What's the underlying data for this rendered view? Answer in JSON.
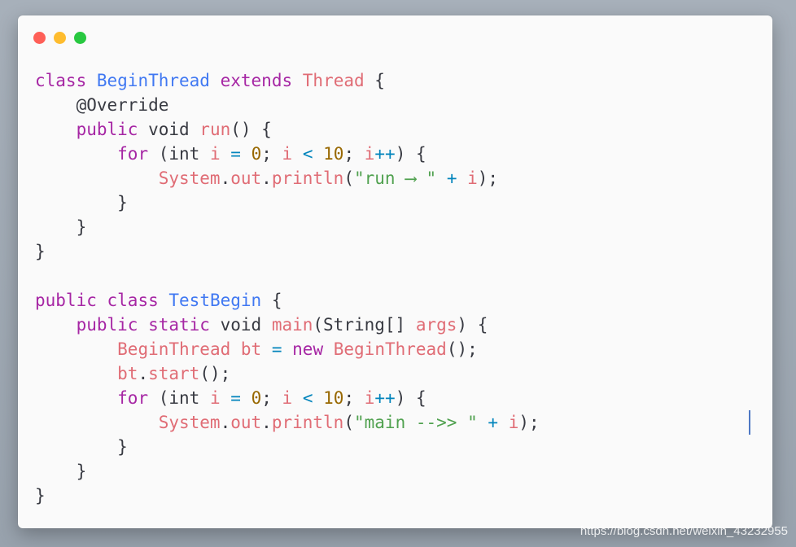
{
  "window": {
    "controls": [
      {
        "name": "close",
        "color": "#fe5f57"
      },
      {
        "name": "minimize",
        "color": "#febc2e"
      },
      {
        "name": "maximize",
        "color": "#28c840"
      }
    ]
  },
  "colors": {
    "keyword": "#a626a4",
    "class_name": "#4078f2",
    "identifier": "#e06c75",
    "number": "#986801",
    "string": "#50a14f",
    "operator": "#0184bc",
    "plain": "#383a42",
    "annotation": "#383a42"
  },
  "code_lines": [
    [
      [
        "keyword",
        "class"
      ],
      [
        "plain",
        " "
      ],
      [
        "class_name",
        "BeginThread"
      ],
      [
        "plain",
        " "
      ],
      [
        "keyword",
        "extends"
      ],
      [
        "plain",
        " "
      ],
      [
        "identifier",
        "Thread"
      ],
      [
        "plain",
        " {"
      ]
    ],
    [
      [
        "plain",
        "    "
      ],
      [
        "annotation",
        "@Override"
      ]
    ],
    [
      [
        "plain",
        "    "
      ],
      [
        "keyword",
        "public"
      ],
      [
        "plain",
        " void "
      ],
      [
        "identifier",
        "run"
      ],
      [
        "plain",
        "() {"
      ]
    ],
    [
      [
        "plain",
        "        "
      ],
      [
        "keyword",
        "for"
      ],
      [
        "plain",
        " (int "
      ],
      [
        "identifier",
        "i"
      ],
      [
        "plain",
        " "
      ],
      [
        "operator",
        "="
      ],
      [
        "plain",
        " "
      ],
      [
        "number",
        "0"
      ],
      [
        "plain",
        "; "
      ],
      [
        "identifier",
        "i"
      ],
      [
        "plain",
        " "
      ],
      [
        "operator",
        "<"
      ],
      [
        "plain",
        " "
      ],
      [
        "number",
        "10"
      ],
      [
        "plain",
        "; "
      ],
      [
        "identifier",
        "i"
      ],
      [
        "operator",
        "++"
      ],
      [
        "plain",
        ") {"
      ]
    ],
    [
      [
        "plain",
        "            "
      ],
      [
        "identifier",
        "System"
      ],
      [
        "plain",
        "."
      ],
      [
        "identifier",
        "out"
      ],
      [
        "plain",
        "."
      ],
      [
        "identifier",
        "println"
      ],
      [
        "plain",
        "("
      ],
      [
        "string",
        "\"run ⟶ \""
      ],
      [
        "plain",
        " "
      ],
      [
        "operator",
        "+"
      ],
      [
        "plain",
        " "
      ],
      [
        "identifier",
        "i"
      ],
      [
        "plain",
        ");"
      ]
    ],
    [
      [
        "plain",
        "        }"
      ]
    ],
    [
      [
        "plain",
        "    }"
      ]
    ],
    [
      [
        "plain",
        "}"
      ]
    ],
    [
      [
        "plain",
        ""
      ]
    ],
    [
      [
        "keyword",
        "public"
      ],
      [
        "plain",
        " "
      ],
      [
        "keyword",
        "class"
      ],
      [
        "plain",
        " "
      ],
      [
        "class_name",
        "TestBegin"
      ],
      [
        "plain",
        " {"
      ]
    ],
    [
      [
        "plain",
        "    "
      ],
      [
        "keyword",
        "public"
      ],
      [
        "plain",
        " "
      ],
      [
        "keyword",
        "static"
      ],
      [
        "plain",
        " void "
      ],
      [
        "identifier",
        "main"
      ],
      [
        "plain",
        "(String[] "
      ],
      [
        "identifier",
        "args"
      ],
      [
        "plain",
        ") {"
      ]
    ],
    [
      [
        "plain",
        "        "
      ],
      [
        "identifier",
        "BeginThread"
      ],
      [
        "plain",
        " "
      ],
      [
        "identifier",
        "bt"
      ],
      [
        "plain",
        " "
      ],
      [
        "operator",
        "="
      ],
      [
        "plain",
        " "
      ],
      [
        "keyword",
        "new"
      ],
      [
        "plain",
        " "
      ],
      [
        "identifier",
        "BeginThread"
      ],
      [
        "plain",
        "();"
      ]
    ],
    [
      [
        "plain",
        "        "
      ],
      [
        "identifier",
        "bt"
      ],
      [
        "plain",
        "."
      ],
      [
        "identifier",
        "start"
      ],
      [
        "plain",
        "();"
      ]
    ],
    [
      [
        "plain",
        "        "
      ],
      [
        "keyword",
        "for"
      ],
      [
        "plain",
        " (int "
      ],
      [
        "identifier",
        "i"
      ],
      [
        "plain",
        " "
      ],
      [
        "operator",
        "="
      ],
      [
        "plain",
        " "
      ],
      [
        "number",
        "0"
      ],
      [
        "plain",
        "; "
      ],
      [
        "identifier",
        "i"
      ],
      [
        "plain",
        " "
      ],
      [
        "operator",
        "<"
      ],
      [
        "plain",
        " "
      ],
      [
        "number",
        "10"
      ],
      [
        "plain",
        "; "
      ],
      [
        "identifier",
        "i"
      ],
      [
        "operator",
        "++"
      ],
      [
        "plain",
        ") {"
      ]
    ],
    [
      [
        "plain",
        "            "
      ],
      [
        "identifier",
        "System"
      ],
      [
        "plain",
        "."
      ],
      [
        "identifier",
        "out"
      ],
      [
        "plain",
        "."
      ],
      [
        "identifier",
        "println"
      ],
      [
        "plain",
        "("
      ],
      [
        "string",
        "\"main -->> \""
      ],
      [
        "plain",
        " "
      ],
      [
        "operator",
        "+"
      ],
      [
        "plain",
        " "
      ],
      [
        "identifier",
        "i"
      ],
      [
        "plain",
        ");"
      ]
    ],
    [
      [
        "plain",
        "        }"
      ]
    ],
    [
      [
        "plain",
        "    }"
      ]
    ],
    [
      [
        "plain",
        "}"
      ]
    ]
  ],
  "watermark": "https://blog.csdn.net/weixin_43232955"
}
